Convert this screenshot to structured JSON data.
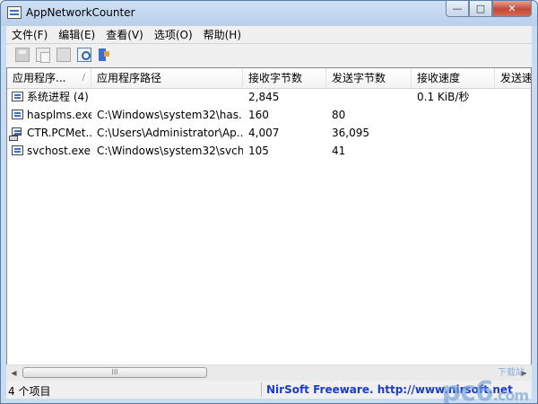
{
  "window": {
    "title": "AppNetworkCounter",
    "controls": {
      "minimize": "—",
      "maximize": "□",
      "close": "✕"
    }
  },
  "menu": [
    "文件(F)",
    "编辑(E)",
    "查看(V)",
    "选项(O)",
    "帮助(H)"
  ],
  "toolbar": {
    "icons": [
      "save-icon",
      "copy-icon",
      "html-report-icon",
      "find-icon",
      "exit-icon"
    ]
  },
  "table": {
    "columns": [
      "应用程序...",
      "应用程序路径",
      "接收字节数",
      "发送字节数",
      "接收速度",
      "发送速"
    ],
    "sort_indicator": "/",
    "rows": [
      {
        "name": "系统进程 (4)",
        "path": "",
        "recv_bytes": "2,845",
        "sent_bytes": "",
        "recv_speed": "0.1 KiB/秒",
        "icon": "window-icon"
      },
      {
        "name": "hasplms.exe",
        "path": "C:\\Windows\\system32\\has...",
        "recv_bytes": "160",
        "sent_bytes": "80",
        "recv_speed": "",
        "icon": "window-icon"
      },
      {
        "name": "CTR.PCMet...",
        "path": "C:\\Users\\Administrator\\Ap...",
        "recv_bytes": "4,007",
        "sent_bytes": "36,095",
        "recv_speed": "",
        "icon": "computer-icon"
      },
      {
        "name": "svchost.exe",
        "path": "C:\\Windows\\system32\\svch...",
        "recv_bytes": "105",
        "sent_bytes": "41",
        "recv_speed": "",
        "icon": "window-icon"
      }
    ]
  },
  "scrollbar": {
    "grip": "III",
    "left_arrow": "◀",
    "right_arrow": "▶"
  },
  "status": {
    "count": "4 个项目",
    "credit": "NirSoft Freeware.  http://www.nirsoft.net"
  },
  "watermark": {
    "logo": "pc6",
    "sub": "下载站",
    "domain": ".com"
  }
}
